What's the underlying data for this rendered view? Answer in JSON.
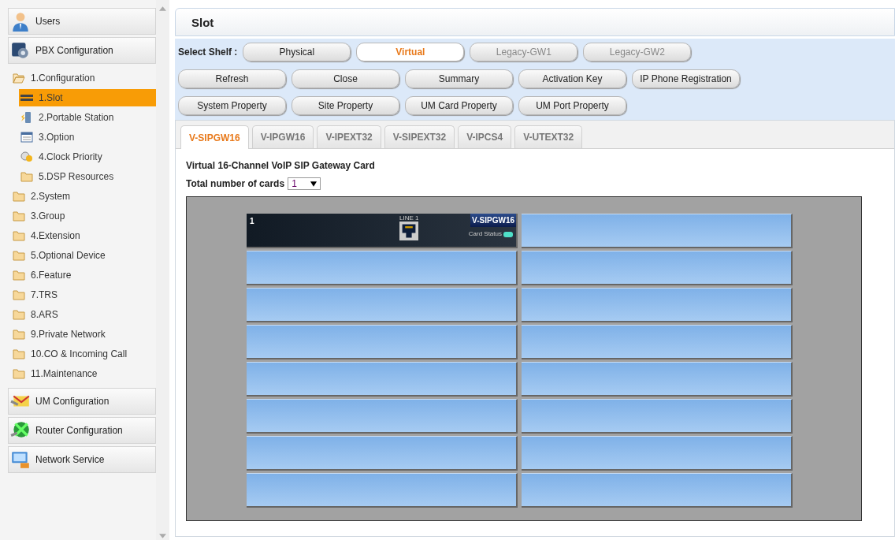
{
  "sidebar": {
    "panels": [
      {
        "label": "Users"
      },
      {
        "label": "PBX Configuration",
        "tree": [
          {
            "label": "1.Configuration",
            "selected": false,
            "expanded": true,
            "children": [
              {
                "label": "1.Slot",
                "selected": true
              },
              {
                "label": "2.Portable Station",
                "selected": false
              },
              {
                "label": "3.Option",
                "selected": false
              },
              {
                "label": "4.Clock Priority",
                "selected": false
              },
              {
                "label": "5.DSP Resources",
                "selected": false
              }
            ]
          },
          {
            "label": "2.System",
            "selected": false,
            "expanded": false
          },
          {
            "label": "3.Group",
            "selected": false,
            "expanded": false
          },
          {
            "label": "4.Extension",
            "selected": false,
            "expanded": false
          },
          {
            "label": "5.Optional Device",
            "selected": false,
            "expanded": false
          },
          {
            "label": "6.Feature",
            "selected": false,
            "expanded": false
          },
          {
            "label": "7.TRS",
            "selected": false,
            "expanded": false
          },
          {
            "label": "8.ARS",
            "selected": false,
            "expanded": false
          },
          {
            "label": "9.Private Network",
            "selected": false,
            "expanded": false
          },
          {
            "label": "10.CO & Incoming Call",
            "selected": false,
            "expanded": false
          },
          {
            "label": "11.Maintenance",
            "selected": false,
            "expanded": false
          }
        ]
      },
      {
        "label": "UM Configuration"
      },
      {
        "label": "Router Configuration"
      },
      {
        "label": "Network Service"
      }
    ]
  },
  "page_title": "Slot",
  "shelf": {
    "label": "Select Shelf :",
    "buttons": [
      {
        "label": "Physical",
        "selected": false,
        "disabled": false
      },
      {
        "label": "Virtual",
        "selected": true,
        "disabled": false
      },
      {
        "label": "Legacy-GW1",
        "selected": false,
        "disabled": true
      },
      {
        "label": "Legacy-GW2",
        "selected": false,
        "disabled": true
      }
    ]
  },
  "action_rows": [
    [
      "Refresh",
      "Close",
      "Summary",
      "Activation Key",
      "IP Phone Registration"
    ],
    [
      "System Property",
      "Site Property",
      "UM Card Property",
      "UM Port Property"
    ]
  ],
  "tabs": [
    {
      "label": "V-SIPGW16",
      "selected": true
    },
    {
      "label": "V-IPGW16",
      "selected": false
    },
    {
      "label": "V-IPEXT32",
      "selected": false
    },
    {
      "label": "V-SIPEXT32",
      "selected": false
    },
    {
      "label": "V-IPCS4",
      "selected": false
    },
    {
      "label": "V-UTEXT32",
      "selected": false
    }
  ],
  "card_title": "Virtual 16-Channel VoIP SIP Gateway Card",
  "total_cards": {
    "label": "Total number of cards",
    "value": "1"
  },
  "slots": [
    {
      "kind": "card",
      "number": "1",
      "name": "V-SIPGW16",
      "port_label": "LINE 1",
      "status_label": "Card Status"
    },
    {
      "kind": "empty"
    },
    {
      "kind": "empty"
    },
    {
      "kind": "empty"
    },
    {
      "kind": "empty"
    },
    {
      "kind": "empty"
    },
    {
      "kind": "empty"
    },
    {
      "kind": "empty"
    },
    {
      "kind": "empty"
    },
    {
      "kind": "empty"
    },
    {
      "kind": "empty"
    },
    {
      "kind": "empty"
    },
    {
      "kind": "empty"
    },
    {
      "kind": "empty"
    },
    {
      "kind": "empty"
    },
    {
      "kind": "empty"
    }
  ]
}
